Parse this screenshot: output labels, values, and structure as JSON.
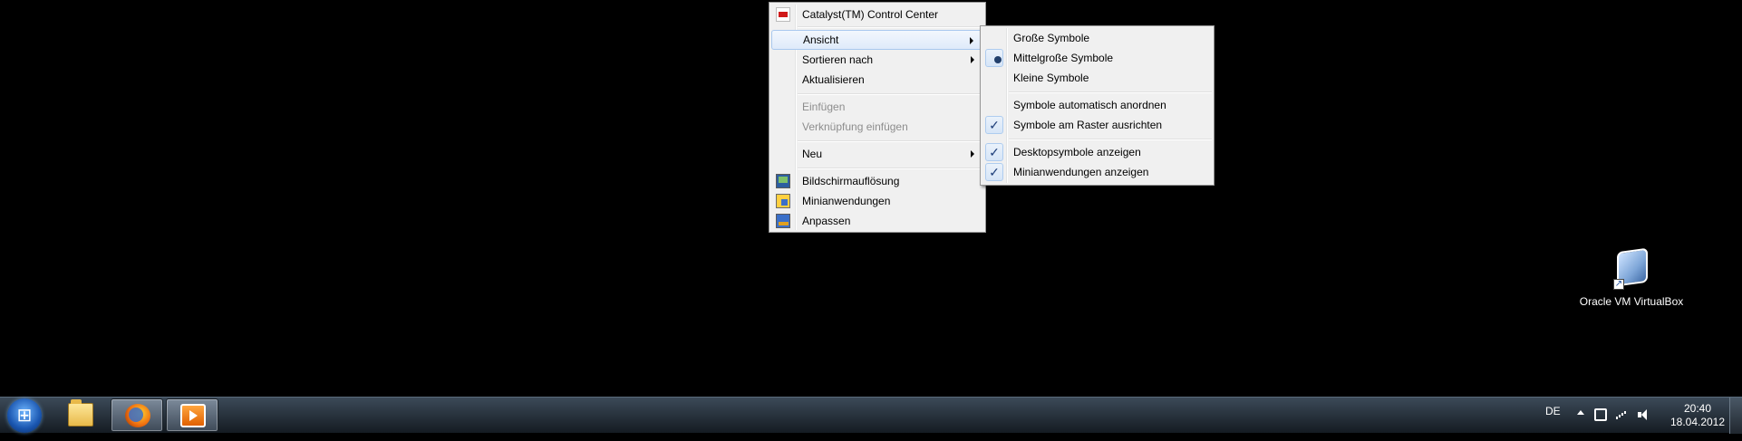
{
  "context_menu": {
    "items": [
      {
        "label": "Catalyst(TM) Control Center",
        "icon": "ati-icon"
      },
      {
        "label": "Ansicht",
        "submenu": true,
        "highlighted": true
      },
      {
        "label": "Sortieren nach",
        "submenu": true
      },
      {
        "label": "Aktualisieren"
      },
      {
        "label": "Einfügen",
        "disabled": true
      },
      {
        "label": "Verknüpfung einfügen",
        "disabled": true
      },
      {
        "label": "Neu",
        "submenu": true
      },
      {
        "label": "Bildschirmauflösung",
        "icon": "display-icon"
      },
      {
        "label": "Minianwendungen",
        "icon": "gadgets-icon"
      },
      {
        "label": "Anpassen",
        "icon": "personalize-icon"
      }
    ]
  },
  "view_submenu": {
    "items": [
      {
        "label": "Große Symbole",
        "selected": false
      },
      {
        "label": "Mittelgroße Symbole",
        "selected": true
      },
      {
        "label": "Kleine Symbole",
        "selected": false
      },
      {
        "label": "Symbole automatisch anordnen",
        "checked": false
      },
      {
        "label": "Symbole am Raster ausrichten",
        "checked": true
      },
      {
        "label": "Desktopsymbole anzeigen",
        "checked": true
      },
      {
        "label": "Minianwendungen anzeigen",
        "checked": true
      }
    ]
  },
  "desktop": {
    "icons": [
      {
        "label": "Oracle VM VirtualBox",
        "icon": "virtualbox-icon"
      }
    ]
  },
  "taskbar": {
    "pinned": [
      {
        "name": "explorer",
        "icon": "folder-icon",
        "active": false
      },
      {
        "name": "firefox",
        "icon": "firefox-icon",
        "active": true
      },
      {
        "name": "media-player",
        "icon": "media-player-icon",
        "active": true
      }
    ],
    "tray": {
      "language": "DE",
      "time": "20:40",
      "date": "18.04.2012"
    }
  },
  "colors": {
    "menu_background": "#f0f0f0",
    "menu_highlight_border": "#a9c8ee",
    "disabled_text": "#8d8d8d",
    "desktop_background": "#000000"
  }
}
